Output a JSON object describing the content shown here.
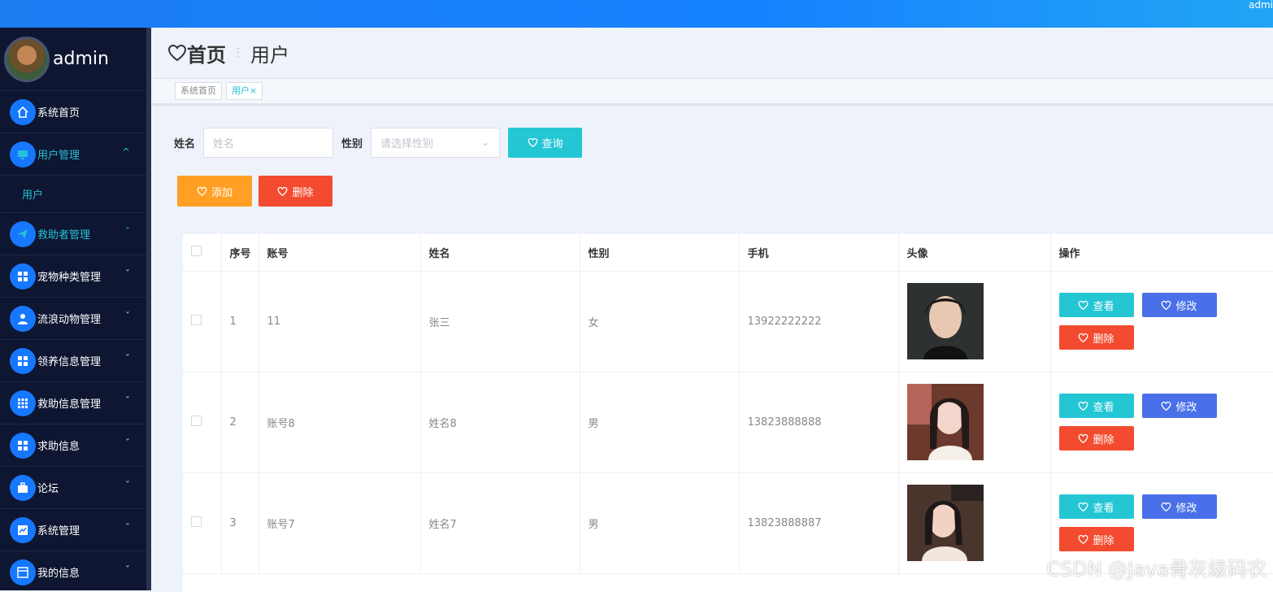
{
  "topbar": {
    "user": "admi"
  },
  "sidebar": {
    "username": "admin",
    "items": [
      {
        "label": "系统首页",
        "icon": "home-icon",
        "chev": ""
      },
      {
        "label": "用户管理",
        "icon": "monitor-icon",
        "chev": "^"
      },
      {
        "label": "救助者管理",
        "icon": "send-icon",
        "chev": "ˇ"
      },
      {
        "label": "宠物种类管理",
        "icon": "grid-icon",
        "chev": "ˇ"
      },
      {
        "label": "流浪动物管理",
        "icon": "user-icon",
        "chev": "ˇ"
      },
      {
        "label": "领养信息管理",
        "icon": "grid-icon",
        "chev": "ˇ"
      },
      {
        "label": "救助信息管理",
        "icon": "apps-icon",
        "chev": "ˇ"
      },
      {
        "label": "求助信息",
        "icon": "grid-icon",
        "chev": "ˇ"
      },
      {
        "label": "论坛",
        "icon": "briefcase-icon",
        "chev": "ˇ"
      },
      {
        "label": "系统管理",
        "icon": "chart-icon",
        "chev": "ˇ"
      },
      {
        "label": "我的信息",
        "icon": "window-icon",
        "chev": "ˇ"
      }
    ],
    "sub_item": "用户"
  },
  "header": {
    "home": "首页",
    "separator": "⋮",
    "current": "用户"
  },
  "tabs": [
    {
      "label": "系统首页"
    },
    {
      "label": "用户×"
    }
  ],
  "search": {
    "name_label": "姓名",
    "name_placeholder": "姓名",
    "gender_label": "性别",
    "gender_placeholder": "请选择性别",
    "query_button": "查询"
  },
  "actions": {
    "add": "添加",
    "delete": "删除"
  },
  "table": {
    "headers": [
      "序号",
      "账号",
      "姓名",
      "性别",
      "手机",
      "头像",
      "操作"
    ],
    "rows": [
      {
        "index": "1",
        "account": "11",
        "name": "张三",
        "gender": "女",
        "phone": "13922222222"
      },
      {
        "index": "2",
        "account": "账号8",
        "name": "姓名8",
        "gender": "男",
        "phone": "13823888888"
      },
      {
        "index": "3",
        "account": "账号7",
        "name": "姓名7",
        "gender": "男",
        "phone": "13823888887"
      }
    ],
    "op_view": "查看",
    "op_edit": "修改",
    "op_delete": "删除"
  },
  "watermark": "CSDN @Java骨灰级码农",
  "colors": {
    "primary": "#1677ff",
    "query": "#24c6d4",
    "add": "#ffa024",
    "danger": "#f34b2f",
    "edit": "#4970e8"
  }
}
